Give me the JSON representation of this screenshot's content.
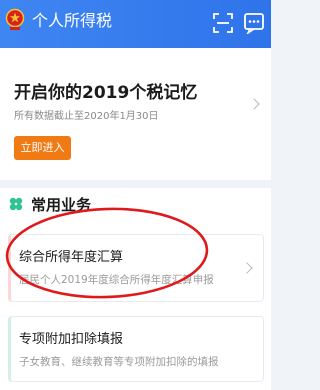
{
  "header": {
    "title": "个人所得税",
    "emblem_icon": "national-emblem-icon",
    "scan_icon": "scan-icon",
    "message_icon": "message-icon",
    "bg_color": "#3a7ff0"
  },
  "banner": {
    "title": "开启你的2019个税记忆",
    "subtitle": "所有数据截止至2020年1月30日",
    "button_label": "立即进入",
    "button_color": "#f07b15"
  },
  "services": {
    "section_title": "常用业务",
    "section_icon": "clover-icon",
    "items": [
      {
        "title": "综合所得年度汇算",
        "description": "居民个人2019年度综合所得年度汇算申报"
      },
      {
        "title": "专项附加扣除填报",
        "description": "子女教育、继续教育等专项附加扣除的填报"
      }
    ]
  },
  "annotation_color": "#e0191b"
}
